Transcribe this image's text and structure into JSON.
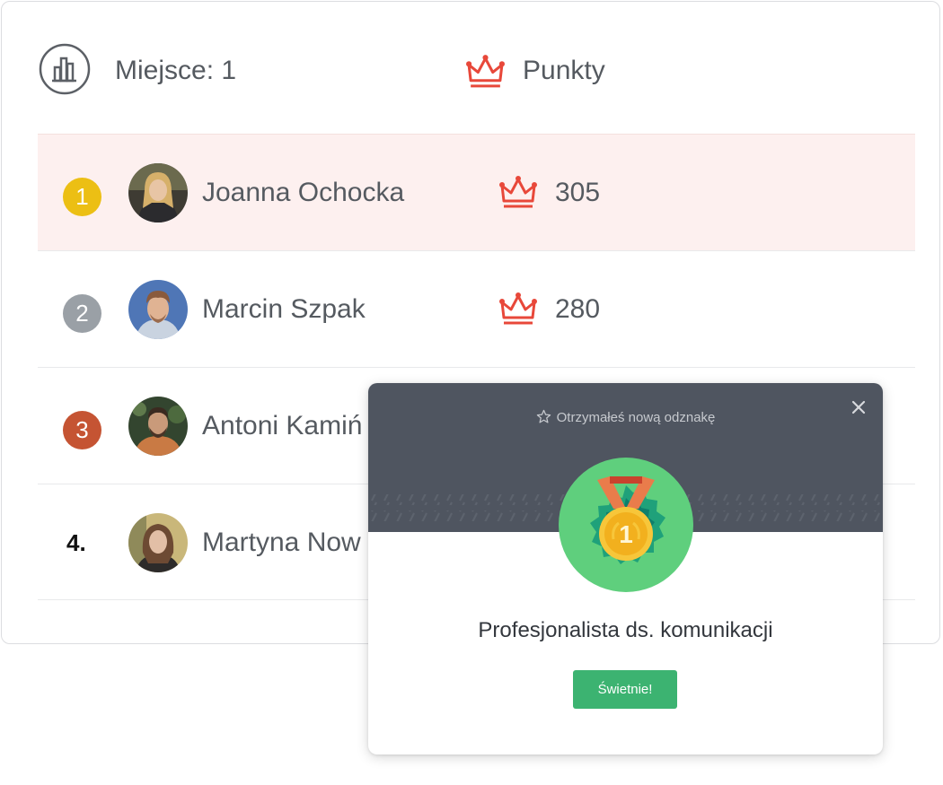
{
  "header": {
    "rank_label": "Miejsce: 1",
    "points_label": "Punkty"
  },
  "leaderboard": [
    {
      "rank": "1",
      "name": "Joanna Ochocka",
      "points": "305",
      "badge_color": "#ecbf14",
      "highlight": true
    },
    {
      "rank": "2",
      "name": "Marcin Szpak",
      "points": "280",
      "badge_color": "#9aa0a6",
      "highlight": false
    },
    {
      "rank": "3",
      "name": "Antoni Kamiń",
      "points": "",
      "badge_color": "#c55433",
      "highlight": false
    },
    {
      "rank": "4.",
      "name": "Martyna Now",
      "points": "",
      "badge_color": "",
      "highlight": false
    }
  ],
  "modal": {
    "title": "Otrzymałeś nową odznakę",
    "badge_name": "Profesjonalista ds. komunikacji",
    "button_label": "Świetnie!",
    "medal_number": "1"
  },
  "colors": {
    "crown": "#e8483a",
    "highlight_row": "#fdf0ef",
    "button": "#3cb371",
    "modal_header": "#4f5560"
  },
  "icons": {
    "rank": "bar-chart-icon",
    "points": "crown-icon",
    "close": "close-icon",
    "title": "star-icon"
  }
}
